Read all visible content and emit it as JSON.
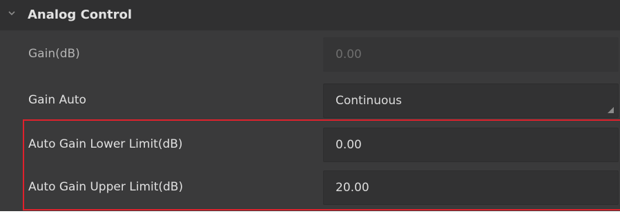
{
  "section": {
    "title": "Analog Control",
    "expanded": true,
    "icon": "chevron-down-icon"
  },
  "rows": [
    {
      "label": "Gain(dB)",
      "value": "0.00",
      "enabled": false
    },
    {
      "label": "Gain Auto",
      "value": "Continuous",
      "enabled": true,
      "type": "dropdown"
    },
    {
      "label": "Auto Gain Lower Limit(dB)",
      "value": "0.00",
      "enabled": true
    },
    {
      "label": "Auto Gain Upper Limit(dB)",
      "value": "20.00",
      "enabled": true
    }
  ],
  "colors": {
    "panel_background": "#3a3a3b",
    "header_background": "#303031",
    "field_background": "#323233",
    "highlight_border": "#e0212c"
  }
}
